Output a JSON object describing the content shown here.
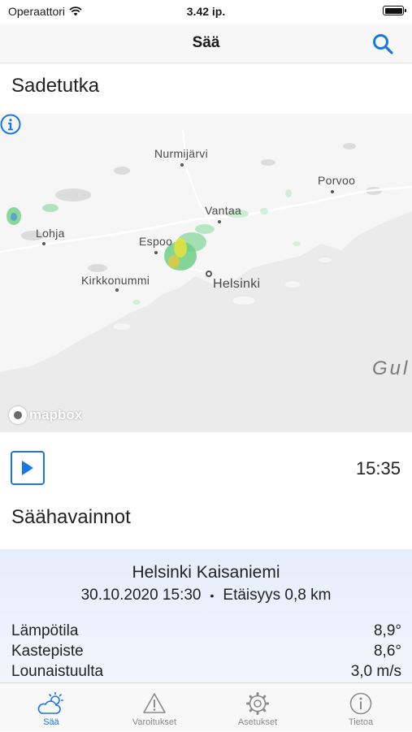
{
  "status_bar": {
    "carrier": "Operaattori",
    "time": "3.42 ip."
  },
  "nav": {
    "title": "Sää"
  },
  "radar": {
    "title": "Sadetutka",
    "time": "15:35",
    "map_labels": {
      "nurmijarvi": "Nurmijärvi",
      "porvoo": "Porvoo",
      "vantaa": "Vantaa",
      "lohja": "Lohja",
      "espoo": "Espoo",
      "kirkkonummi": "Kirkkonummi",
      "helsinki": "Helsinki",
      "gulf": "Gul"
    },
    "attribution": "mapbox"
  },
  "observations": {
    "title": "Säähavainnot",
    "station": "Helsinki Kaisaniemi",
    "datetime": "30.10.2020 15:30",
    "separator": "•",
    "distance": "Etäisyys 0,8 km",
    "rows": [
      {
        "label": "Lämpötila",
        "value": "8,9°"
      },
      {
        "label": "Kastepiste",
        "value": "8,6°"
      },
      {
        "label": "Lounaistuulta",
        "value": "3,0 m/s"
      }
    ]
  },
  "tabs": [
    {
      "label": "Sää",
      "icon": "cloud-sun-icon",
      "active": true
    },
    {
      "label": "Varoitukset",
      "icon": "warning-icon",
      "active": false
    },
    {
      "label": "Asetukset",
      "icon": "gear-icon",
      "active": false
    },
    {
      "label": "Tietoa",
      "icon": "info-icon",
      "active": false
    }
  ],
  "colors": {
    "accent": "#1877e6",
    "water": "#ececec",
    "land": "#f5f5f5",
    "card": "#e6eefb"
  }
}
